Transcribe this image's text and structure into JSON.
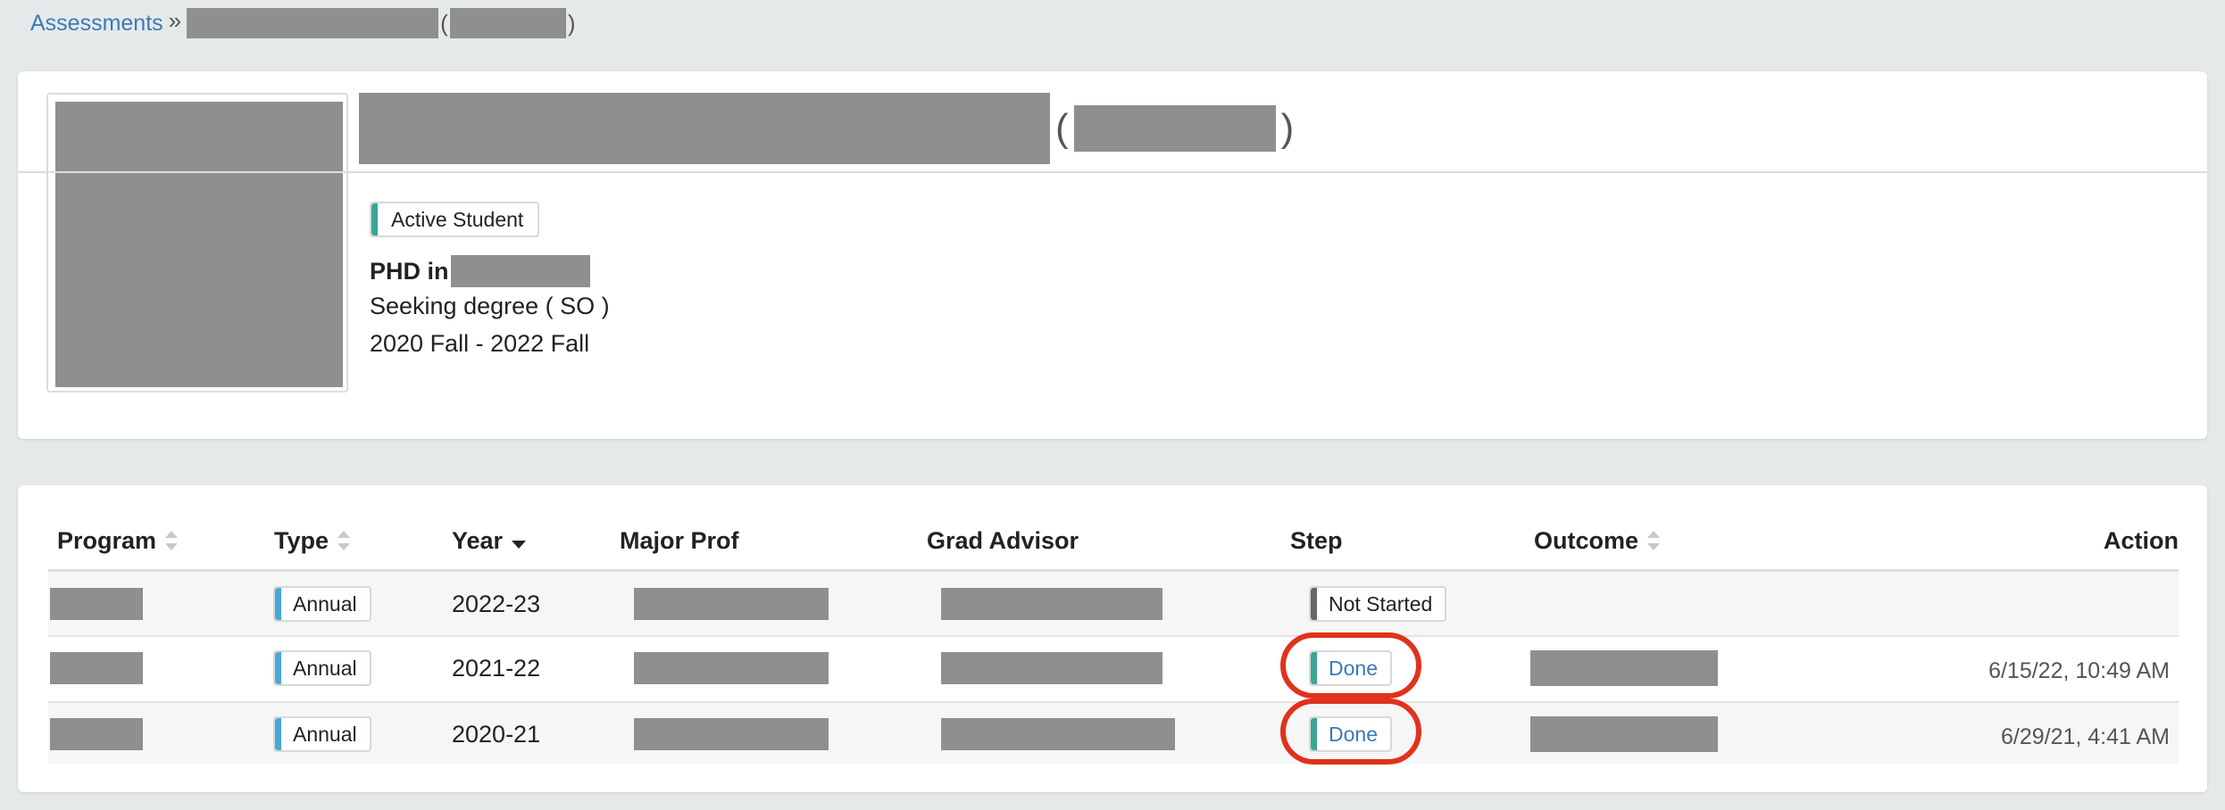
{
  "breadcrumb": {
    "root": "Assessments",
    "separator": "»",
    "open_paren": "(",
    "close_paren": ")"
  },
  "profile": {
    "open_paren": "(",
    "close_paren": ")",
    "status": "Active Student",
    "degree_prefix": "PHD in",
    "seeking": "Seeking degree ( SO )",
    "terms": "2020 Fall - 2022 Fall"
  },
  "table": {
    "headers": {
      "program": "Program",
      "type": "Type",
      "year": "Year",
      "major_prof": "Major Prof",
      "grad_advisor": "Grad Advisor",
      "step": "Step",
      "outcome": "Outcome",
      "action": "Action"
    },
    "rows": [
      {
        "type": "Annual",
        "year": "2022-23",
        "step": "Not Started",
        "action": ""
      },
      {
        "type": "Annual",
        "year": "2021-22",
        "step": "Done",
        "action": "6/15/22, 10:49 AM"
      },
      {
        "type": "Annual",
        "year": "2020-21",
        "step": "Done",
        "action": "6/29/21, 4:41 AM"
      }
    ]
  },
  "colors": {
    "link": "#3a7ab8",
    "active_accent": "#3aa595",
    "type_accent": "#4aa8d8",
    "highlight": "#e0321c",
    "redaction": "#8f8f8f"
  }
}
